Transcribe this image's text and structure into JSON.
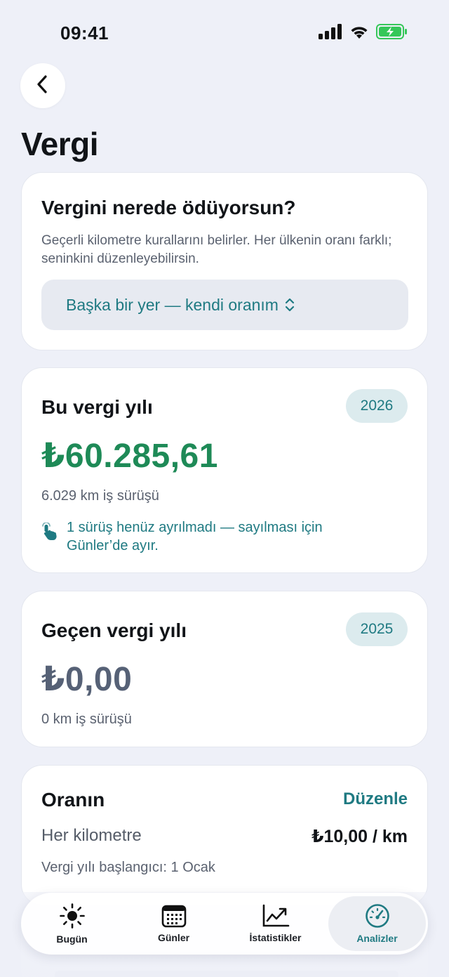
{
  "status": {
    "time": "09:41"
  },
  "page": {
    "title": "Vergi"
  },
  "location_card": {
    "title": "Vergini nerede ödüyorsun?",
    "description": "Geçerli kilometre kurallarını belirler. Her ülkenin oranı farklı; seninkini düzenleyebilirsin.",
    "selected_option": "Başka bir yer — kendi oranım"
  },
  "current_year_card": {
    "title": "Bu vergi yılı",
    "year": "2026",
    "amount": "₺60.285,61",
    "km_text": "6.029 km iş sürüşü",
    "note": "1 sürüş henüz ayrılmadı — sayılması için Günler’de ayır."
  },
  "previous_year_card": {
    "title": "Geçen vergi yılı",
    "year": "2025",
    "amount": "₺0,00",
    "km_text": "0 km iş sürüşü"
  },
  "rate_card": {
    "title": "Oranın",
    "edit_label": "Düzenle",
    "rate_label": "Her kilometre",
    "rate_value": "₺10,00 / km",
    "start_label": "Vergi yılı başlangıcı: 1 Ocak"
  },
  "tabbar": {
    "tabs": [
      {
        "label": "Bugün",
        "icon": "sun-icon",
        "active": false
      },
      {
        "label": "Günler",
        "icon": "calendar-icon",
        "active": false
      },
      {
        "label": "İstatistikler",
        "icon": "chart-trend-icon",
        "active": false
      },
      {
        "label": "Analizler",
        "icon": "gauge-icon",
        "active": true
      }
    ]
  },
  "colors": {
    "accent": "#1f7a82",
    "amount_positive": "#1e8a57",
    "amount_zero": "#566176",
    "background": "#eef0f8"
  }
}
